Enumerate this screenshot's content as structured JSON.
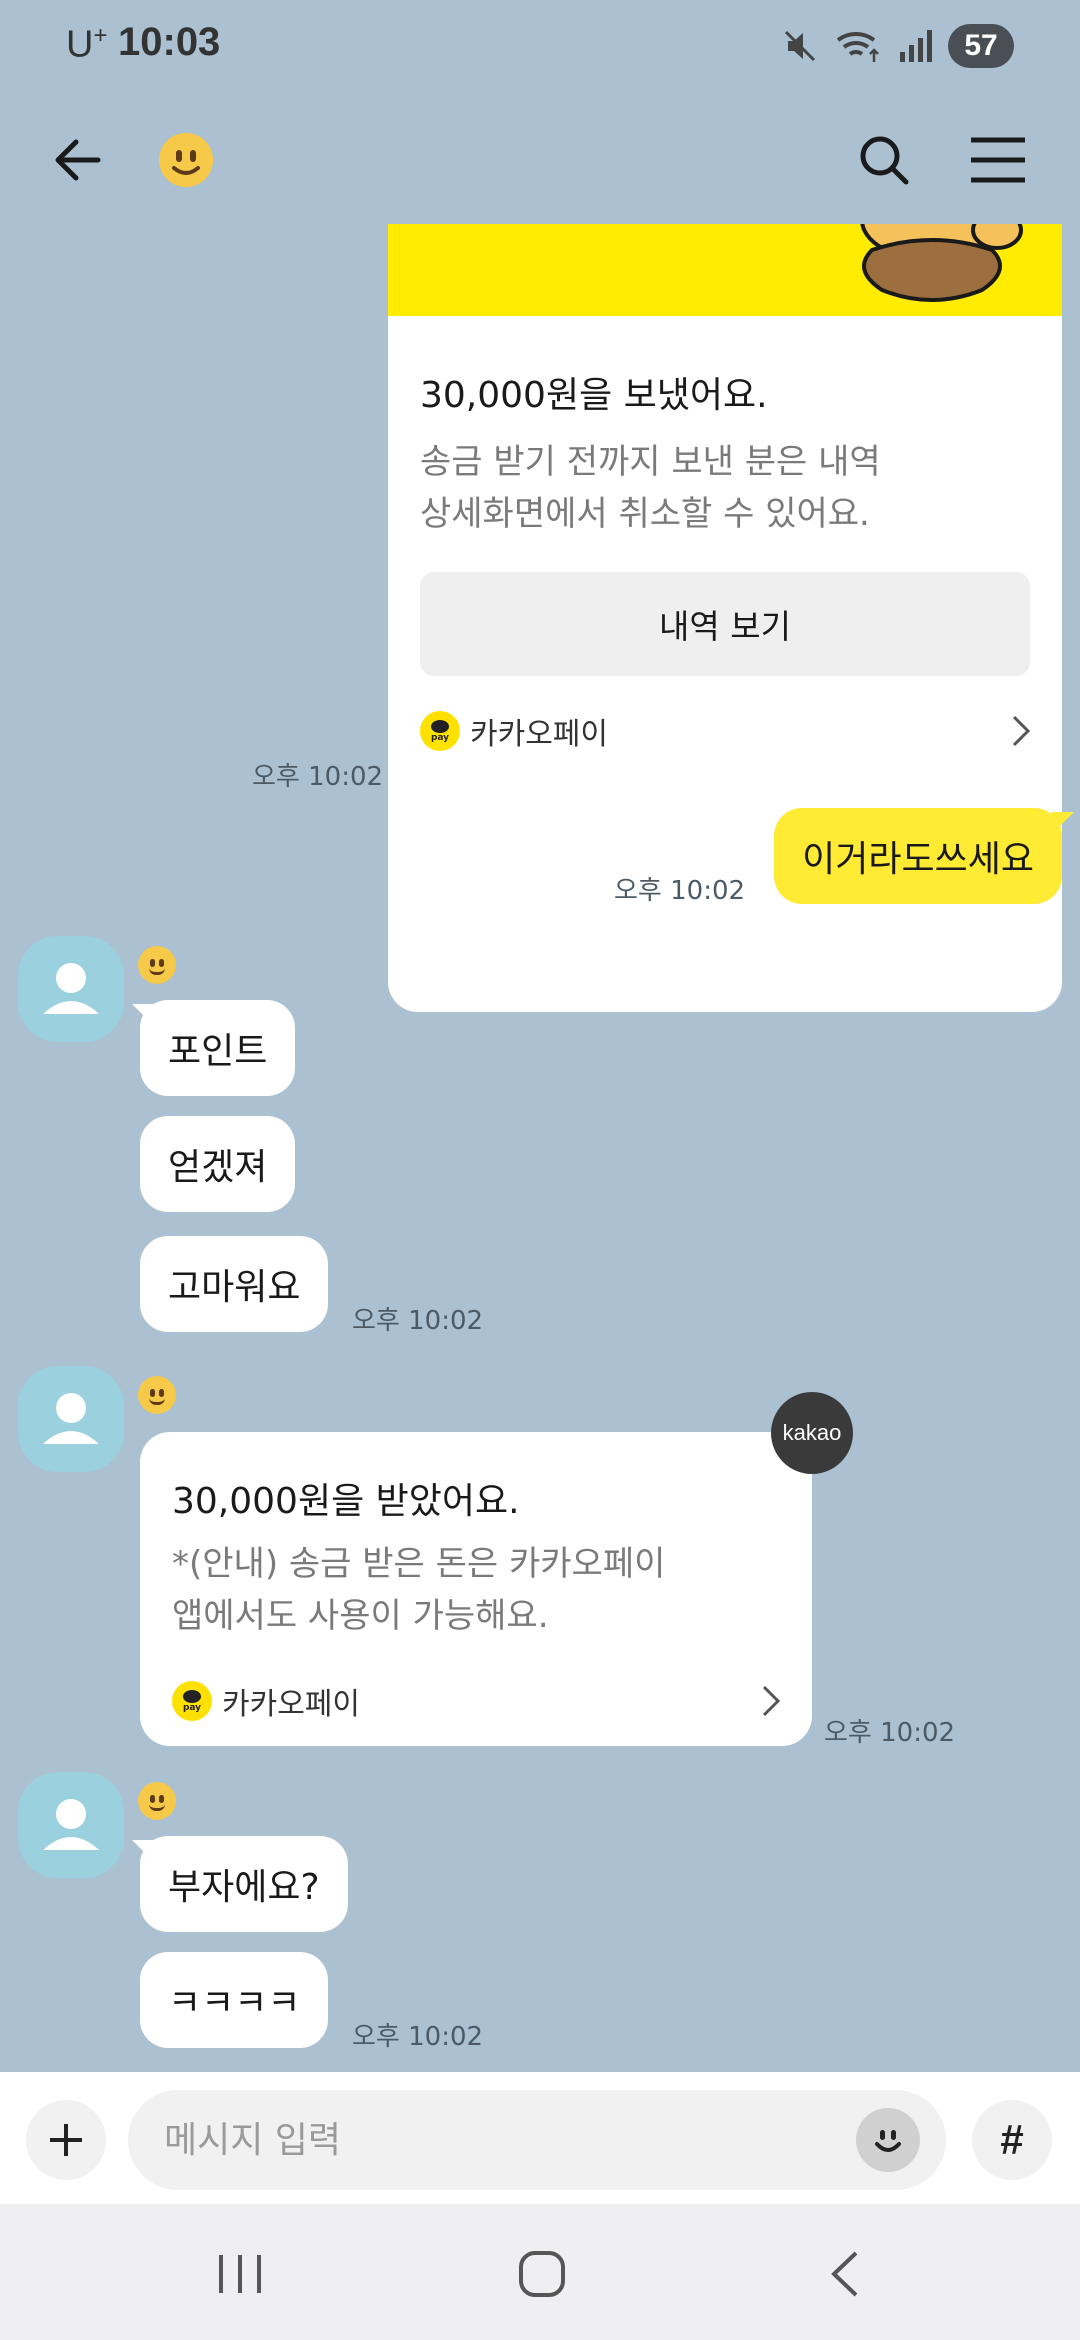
{
  "status_bar": {
    "carrier": "U",
    "carrier_sup": "+",
    "time": "10:03",
    "battery": "57"
  },
  "header": {
    "back_icon": "arrow-left-icon",
    "profile_emoji_icon": "smiley-icon",
    "search_icon": "search-icon",
    "menu_icon": "hamburger-menu-icon"
  },
  "messages": {
    "sent_transfer": {
      "title": "30,000원을 보냈어요.",
      "desc_line1": "송금 받기 전까지 보낸 분은 내역",
      "desc_line2": "상세화면에서 취소할 수 있어요.",
      "button": "내역 보기",
      "footer": "카카오페이",
      "pay_label": "pay",
      "time": "오후 10:02"
    },
    "sent_text": {
      "text": "이거라도쓰세요",
      "time": "오후 10:02"
    },
    "recv_group1": {
      "bubbles": [
        "포인트",
        "얻겠져",
        "고마워요"
      ],
      "time": "오후 10:02"
    },
    "recv_transfer": {
      "title": "30,000원을 받았어요.",
      "desc_line1": "*(안내) 송금 받은 돈은 카카오페이",
      "desc_line2": "앱에서도 사용이 가능해요.",
      "footer": "카카오페이",
      "pay_label": "pay",
      "badge": "kakao",
      "time": "오후 10:02"
    },
    "recv_group2": {
      "bubbles": [
        "부자에요?",
        "ㅋㅋㅋㅋ"
      ],
      "time": "오후 10:02"
    }
  },
  "input_bar": {
    "placeholder": "메시지 입력",
    "hash": "#"
  },
  "colors": {
    "chat_bg": "#abc1d1",
    "sent_bubble": "#ffeb34",
    "kakao_yellow": "#ffec00",
    "avatar_bg": "#9bd1df"
  }
}
